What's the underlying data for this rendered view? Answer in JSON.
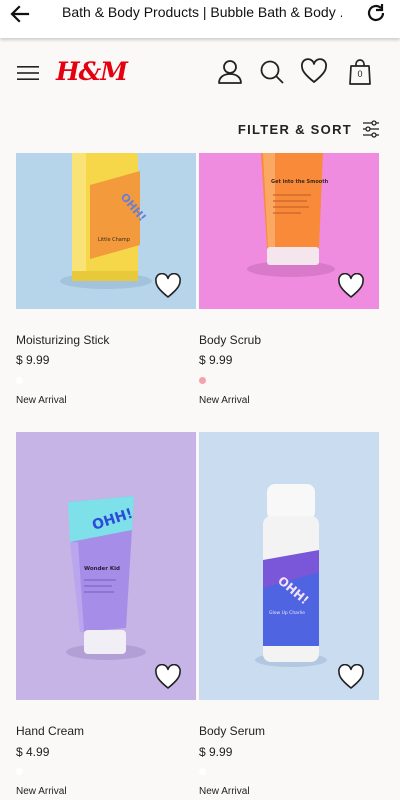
{
  "browser": {
    "title": "Bath & Body Products | Bubble Bath & Body ..."
  },
  "header": {
    "logo": "H&M",
    "bag_count": "0"
  },
  "filter": {
    "label": "FILTER & SORT"
  },
  "products": [
    {
      "name": "Moisturizing Stick",
      "price": "$ 9.99",
      "badge": "New Arrival",
      "swatch_color": "#ffffff"
    },
    {
      "name": "Body Scrub",
      "price": "$ 9.99",
      "badge": "New Arrival",
      "swatch_color": "#f3a3ae"
    },
    {
      "name": "Hand Cream",
      "price": "$ 4.99",
      "badge": "New Arrival",
      "swatch_color": "#ffffff"
    },
    {
      "name": "Body Serum",
      "price": "$ 9.99",
      "badge": "New Arrival",
      "swatch_color": "#ffffff"
    }
  ],
  "packaging": {
    "stick_name": "Little Champ",
    "scrub_name": "Get into the Smooth",
    "cream_name": "Wonder Kid",
    "serum_name": "Glow Up Charlie",
    "brand": "OHH!"
  },
  "colors": {
    "brand_red": "#e50010",
    "bg_blue": "#b6d4ea",
    "bg_pink": "#f08ce0",
    "bg_purple": "#c6b4e6",
    "bg_lightblue": "#c9dcf0"
  }
}
